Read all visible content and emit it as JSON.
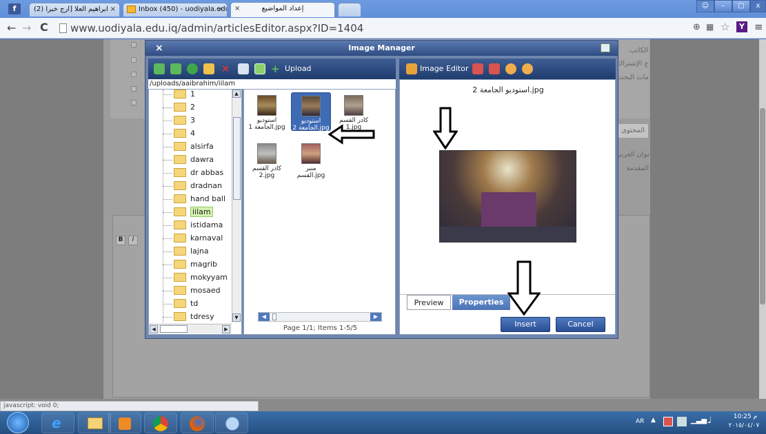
{
  "browser": {
    "tabs": [
      {
        "label": "(2) ابراهيم العلا [ارج خبرا"
      },
      {
        "label": "Inbox (450) - uodiyala.edu"
      },
      {
        "label": "إعداد المواضيع"
      }
    ],
    "url": "www.uodiyala.edu.iq/admin/articlesEditor.aspx?ID=1404",
    "status": "javascript: void 0;"
  },
  "background_page": {
    "labels": [
      "الكاتب",
      "نوع الإشتراك",
      "كلمات البحث",
      "المحتوى",
      "العنوان العربي",
      "المقدمة"
    ]
  },
  "dialog": {
    "title": "Image Manager",
    "close": "×",
    "upload_label": "Upload",
    "path": "/uploads/aaibrahim/iilam",
    "folders": [
      "1",
      "2",
      "3",
      "4",
      "alsirfa",
      "dawra",
      "dr abbas",
      "dradnan",
      "hand ball",
      "iilam",
      "istidama",
      "karnaval",
      "lajna",
      "magrib",
      "mokyyam",
      "mosaed",
      "td",
      "tdresy"
    ],
    "selected_folder": "iilam",
    "files": [
      {
        "name": "استوديو الجامعة 1.jpg"
      },
      {
        "name": "استوديو الجامعة 2.jpg"
      },
      {
        "name": "كادر القسم 1.jpg"
      },
      {
        "name": "كادر القسم 2.jpg"
      },
      {
        "name": "منبر القسم.jpg"
      }
    ],
    "pager": "Page 1/1; Items 1-5/5",
    "editor_label": "Image Editor",
    "preview_caption": "استوديو الجامعة 2.jpg",
    "tabs": [
      "Preview",
      "Properties"
    ],
    "insert": "Insert",
    "cancel": "Cancel"
  },
  "taskbar": {
    "lang": "AR",
    "time": "10:25 م",
    "date": "٢٠١٥/٠٤/٠٧"
  },
  "colors": {
    "accent": "#2f4d83",
    "selection": "#3e6bb5"
  }
}
